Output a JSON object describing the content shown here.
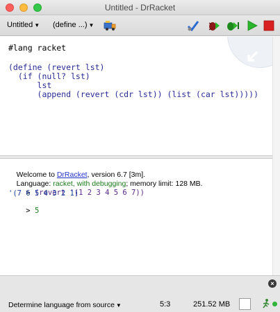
{
  "window": {
    "title": "Untitled - DrRacket"
  },
  "toolbar": {
    "file_menu_label": "Untitled",
    "define_menu_label": "(define ...)",
    "icons": [
      "macro-stepper-icon",
      "check-syntax-icon",
      "debug-icon",
      "step-icon",
      "run-icon",
      "stop-icon"
    ],
    "colors": {
      "run": "#2ab52a",
      "stop": "#d92020"
    }
  },
  "editor": {
    "lines": [
      "#lang racket",
      "",
      "(define (revert lst)",
      "  (if (null? lst)",
      "      lst",
      "      (append (revert (cdr lst)) (list (car lst)))))"
    ]
  },
  "interactions": {
    "welcome_prefix": "Welcome to ",
    "welcome_link": "DrRacket",
    "welcome_suffix": ", version 6.7 [3m].",
    "language_prefix": "Language: ",
    "language_name": "racket, with debugging",
    "language_suffix": "; memory limit: 128 MB.",
    "prompt1": "> ",
    "input1": "(revert '(1 2 3 4 5 6 7))",
    "output1": "'(7 6 5 4 3 2 1)",
    "prompt2": "> ",
    "input2": "5"
  },
  "statusbar": {
    "language_selector": "Determine language from source",
    "position": "5:3",
    "memory": "251.52 MB"
  }
}
